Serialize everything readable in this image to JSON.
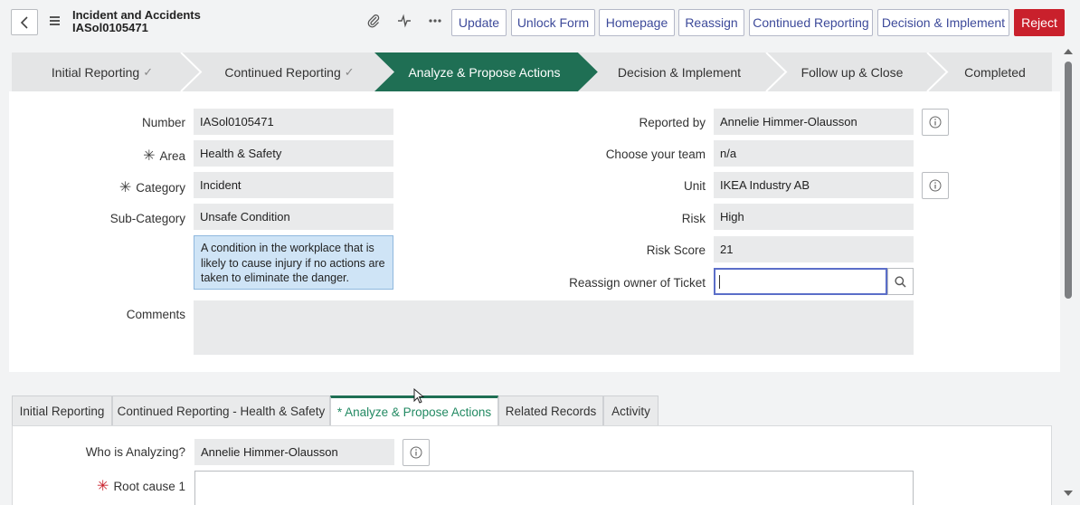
{
  "header": {
    "title": "Incident and Accidents",
    "record_number": "IASol0105471",
    "icons": [
      "paperclip-icon",
      "activity-pulse-icon",
      "more-options-icon"
    ],
    "buttons": {
      "update": "Update",
      "unlock_form": "Unlock Form",
      "homepage": "Homepage",
      "reassign": "Reassign",
      "continued_reporting": "Continued Reporting",
      "decision_implement": "Decision & Implement",
      "reject": "Reject"
    }
  },
  "process_flow": {
    "stages": [
      {
        "label": "Initial Reporting",
        "state": "complete",
        "check": "✓"
      },
      {
        "label": "Continued Reporting",
        "state": "complete",
        "check": "✓"
      },
      {
        "label": "Analyze & Propose Actions",
        "state": "active",
        "check": ""
      },
      {
        "label": "Decision & Implement",
        "state": "pending",
        "check": ""
      },
      {
        "label": "Follow up & Close",
        "state": "pending",
        "check": ""
      },
      {
        "label": "Completed",
        "state": "pending",
        "check": ""
      }
    ],
    "active_color": "#1f6f54"
  },
  "form": {
    "left": {
      "number": {
        "label": "Number",
        "value": "IASol0105471"
      },
      "area": {
        "label": "Area",
        "value": "Health & Safety",
        "required_mark": "✳"
      },
      "category": {
        "label": "Category",
        "value": "Incident",
        "required_mark": "✳"
      },
      "sub_category": {
        "label": "Sub-Category",
        "value": "Unsafe Condition"
      },
      "help_text": "A condition in the workplace that is likely to cause injury if no actions are taken to eliminate the danger.",
      "comments": {
        "label": "Comments",
        "value": ""
      }
    },
    "right": {
      "reported_by": {
        "label": "Reported by",
        "value": "Annelie Himmer-Olausson"
      },
      "team": {
        "label": "Choose your team",
        "value": "n/a"
      },
      "unit": {
        "label": "Unit",
        "value": "IKEA Industry AB"
      },
      "risk": {
        "label": "Risk",
        "value": "High"
      },
      "risk_score": {
        "label": "Risk Score",
        "value": "21"
      },
      "reassign_owner": {
        "label": "Reassign owner of Ticket",
        "value": ""
      }
    }
  },
  "tabs": {
    "items": [
      {
        "label": "Initial Reporting"
      },
      {
        "label": "Continued Reporting - Health & Safety"
      },
      {
        "label": "* Analyze & Propose Actions"
      },
      {
        "label": "Related Records"
      },
      {
        "label": "Activity"
      }
    ],
    "active_index": 2
  },
  "analyze_section": {
    "who_is_analyzing": {
      "label": "Who is Analyzing?",
      "value": "Annelie Himmer-Olausson"
    },
    "root_cause_1": {
      "label": "Root cause 1",
      "value": "",
      "required_mark": "✳"
    }
  },
  "colors": {
    "accent_blue": "#3d4a9a",
    "reject_red": "#c9202c",
    "active_green": "#1f6f54",
    "field_gray": "#e9eaeb"
  }
}
